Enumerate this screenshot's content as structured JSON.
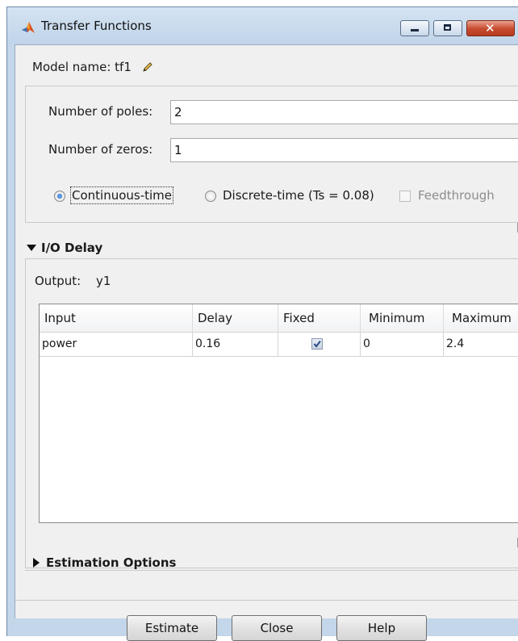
{
  "window": {
    "title": "Transfer Functions",
    "close_glyph": "✕"
  },
  "model": {
    "label": "Model name: tf1",
    "edit_icon": "pencil-icon"
  },
  "params": {
    "poles_label": "Number of poles:",
    "poles_value": "2",
    "zeros_label": "Number of zeros:",
    "zeros_value": "1",
    "continuous_label": "Continuous-time",
    "continuous_selected": true,
    "discrete_label": "Discrete-time (Ts = 0.08)",
    "feedthrough_label": "Feedthrough",
    "feedthrough_enabled": false
  },
  "io_delay": {
    "header": "I/O Delay",
    "expanded": true,
    "output_label": "Output:",
    "output_value": "y1",
    "columns": [
      "Input",
      "Delay",
      "Fixed",
      "Minimum",
      "Maximum"
    ],
    "rows": [
      {
        "input": "power",
        "delay": "0.16",
        "fixed": true,
        "minimum": "0",
        "maximum": "2.4"
      }
    ]
  },
  "estimation_options": {
    "header": "Estimation Options",
    "expanded": false
  },
  "buttons": {
    "estimate": "Estimate",
    "close": "Close",
    "help": "Help"
  },
  "colors": {
    "title_bar": "#c3d6ea",
    "close_button": "#c64a2d",
    "panel_background": "#f0f0f0"
  }
}
